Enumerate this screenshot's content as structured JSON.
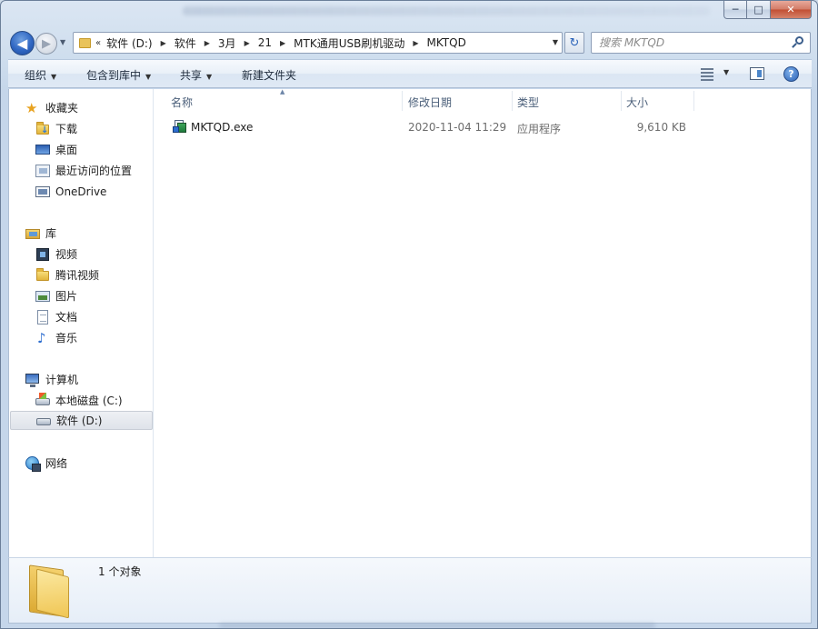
{
  "window": {
    "caption": {
      "minimize": "─",
      "maximize": "□",
      "close": "✕"
    }
  },
  "nav": {
    "back_glyph": "◀",
    "forward_glyph": "▶",
    "address": {
      "overflow": "«",
      "crumbs": [
        "软件 (D:)",
        "软件",
        "3月",
        "21",
        "MTK通用USB刷机驱动",
        "MKTQD"
      ]
    },
    "refresh_glyph": "↻",
    "search_placeholder": "搜索 MKTQD"
  },
  "toolbar": {
    "organize": "组织",
    "include_in_library": "包含到库中",
    "share": "共享",
    "new_folder": "新建文件夹"
  },
  "sidebar": {
    "favorites": {
      "label": "收藏夹",
      "items": [
        "下载",
        "桌面",
        "最近访问的位置",
        "OneDrive"
      ]
    },
    "libraries": {
      "label": "库",
      "items": [
        "视频",
        "腾讯视频",
        "图片",
        "文档",
        "音乐"
      ]
    },
    "computer": {
      "label": "计算机",
      "items": [
        "本地磁盘 (C:)",
        "软件 (D:)"
      ],
      "selected": "软件 (D:)"
    },
    "network": {
      "label": "网络"
    }
  },
  "columns": {
    "name": "名称",
    "date_modified": "修改日期",
    "type": "类型",
    "size": "大小"
  },
  "files": [
    {
      "name": "MKTQD.exe",
      "date_modified": "2020-11-04 11:29",
      "type": "应用程序",
      "size": "9,610 KB"
    }
  ],
  "details": {
    "summary": "1 个对象"
  },
  "colors": {
    "accent": "#2f66c2",
    "selection_bg": "#dfe3ea",
    "window_frame": "#cfdeee"
  }
}
